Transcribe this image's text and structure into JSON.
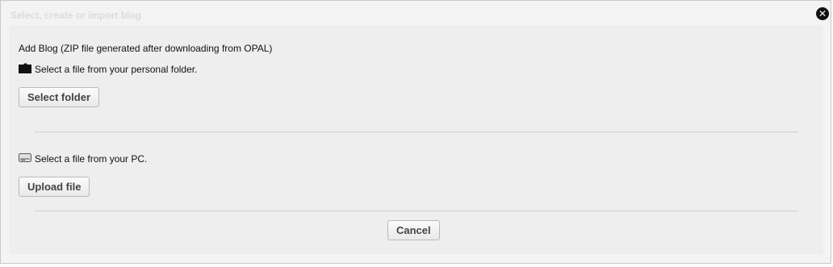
{
  "dialog": {
    "title": "Select, create or import blog",
    "close_icon": "close-icon",
    "intro": "Add Blog (ZIP file generated after downloading from OPAL)",
    "folder_source": {
      "icon": "folder-icon",
      "label": "Select a file from your personal folder.",
      "button_label": "Select folder"
    },
    "pc_source": {
      "icon": "hard-drive-icon",
      "label": "Select a file from your PC.",
      "button_label": "Upload file"
    },
    "cancel_label": "Cancel"
  }
}
